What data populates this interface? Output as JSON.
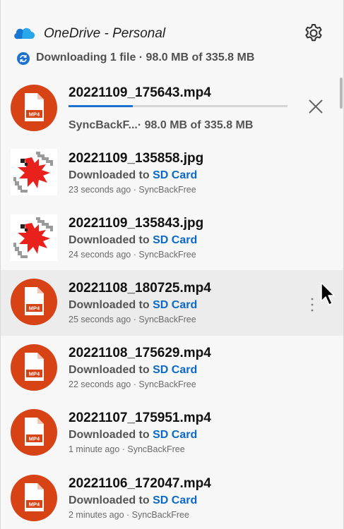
{
  "header": {
    "title": "OneDrive - Personal",
    "status": "Downloading 1 file · 98.0 MB of 335.8 MB"
  },
  "icons": {
    "app": "onedrive-cloud-icon",
    "settings": "gear-icon",
    "sync": "sync-icon",
    "cancel": "close-icon",
    "more": "more-vertical-icon",
    "cursor": "mouse-cursor-icon"
  },
  "colors": {
    "link": "#0b6ac8",
    "progress": "#1d72cf",
    "mp4_badge": "#d84315",
    "cloud": "#1976d2"
  },
  "current": {
    "filename": "20221109_175643.mp4",
    "detail": "SyncBackF...· 98.0 MB of 335.8 MB",
    "progress_fraction": 0.292,
    "thumb_label": "MP4"
  },
  "items": [
    {
      "filename": "20221109_135858.jpg",
      "prefix": "Downloaded to ",
      "location": "SD Card",
      "meta": "23 seconds ago · SyncBackFree",
      "type": "jpg"
    },
    {
      "filename": "20221109_135843.jpg",
      "prefix": "Downloaded to ",
      "location": "SD Card",
      "meta": "24 seconds ago · SyncBackFree",
      "type": "jpg"
    },
    {
      "filename": "20221108_180725.mp4",
      "prefix": "Downloaded to ",
      "location": "SD Card",
      "meta": "25 seconds ago · SyncBackFree",
      "type": "mp4",
      "thumb_label": "MP4"
    },
    {
      "filename": "20221108_175629.mp4",
      "prefix": "Downloaded to ",
      "location": "SD Card",
      "meta": "22 seconds ago · SyncBackFree",
      "type": "mp4",
      "thumb_label": "MP4"
    },
    {
      "filename": "20221107_175951.mp4",
      "prefix": "Downloaded to ",
      "location": "SD Card",
      "meta": "1 minute ago · SyncBackFree",
      "type": "mp4",
      "thumb_label": "MP4"
    },
    {
      "filename": "20221106_172047.mp4",
      "prefix": "Downloaded to ",
      "location": "SD Card",
      "meta": "2 minutes ago · SyncBackFree",
      "type": "mp4",
      "thumb_label": "MP4"
    }
  ]
}
